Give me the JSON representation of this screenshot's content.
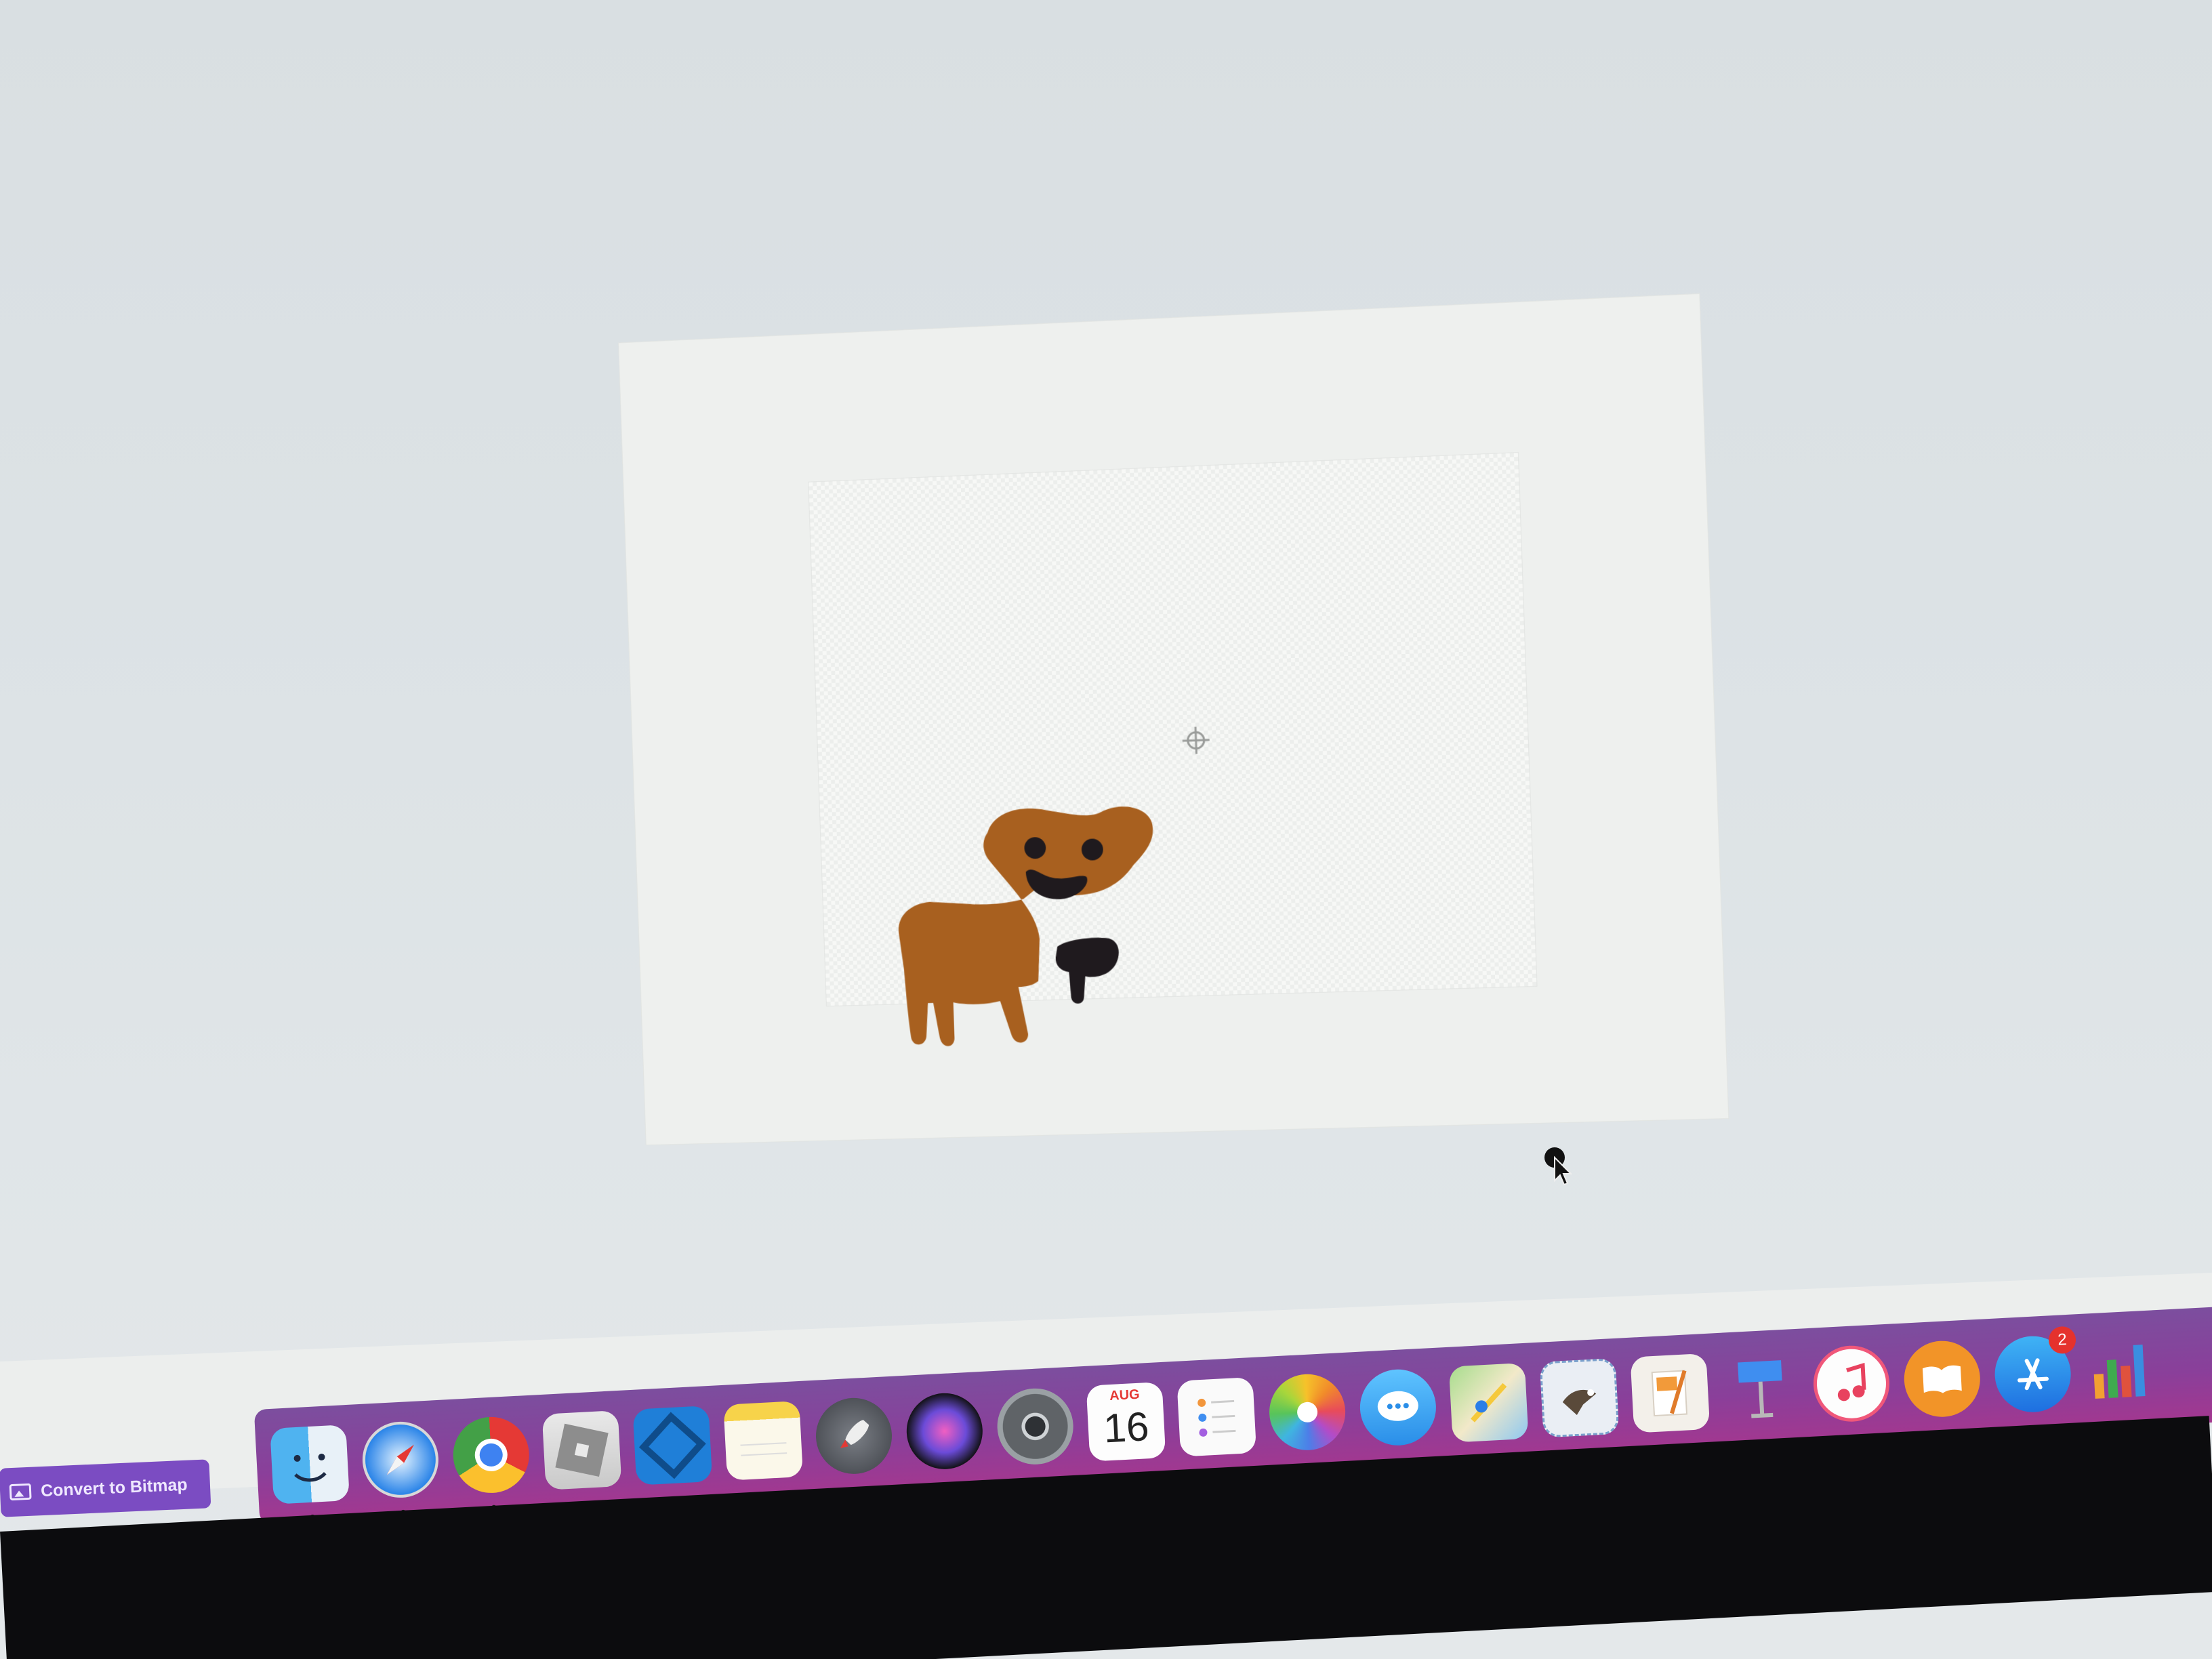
{
  "app": {
    "convert_button_label": "Convert to Bitmap"
  },
  "colors": {
    "bear_fill": "#a8601f",
    "bear_features": "#1f1a1e",
    "convert_button_bg": "#7b4cc2",
    "dock_gradient_start": "#7c4e9e",
    "dock_gradient_end": "#a4378f"
  },
  "dock": {
    "calendar_month": "AUG",
    "calendar_day": "16",
    "app_store_badge": "2",
    "icons": [
      "finder-icon",
      "safari-icon",
      "chrome-icon",
      "roblox-icon",
      "roblox-studio-icon",
      "notes-icon",
      "launchpad-icon",
      "siri-icon",
      "system-preferences-icon",
      "calendar-icon",
      "reminders-icon",
      "photos-icon",
      "messages-icon",
      "maps-icon",
      "mail-icon",
      "pages-icon",
      "keynote-icon",
      "itunes-icon",
      "ibooks-icon",
      "app-store-icon",
      "numbers-icon"
    ]
  }
}
